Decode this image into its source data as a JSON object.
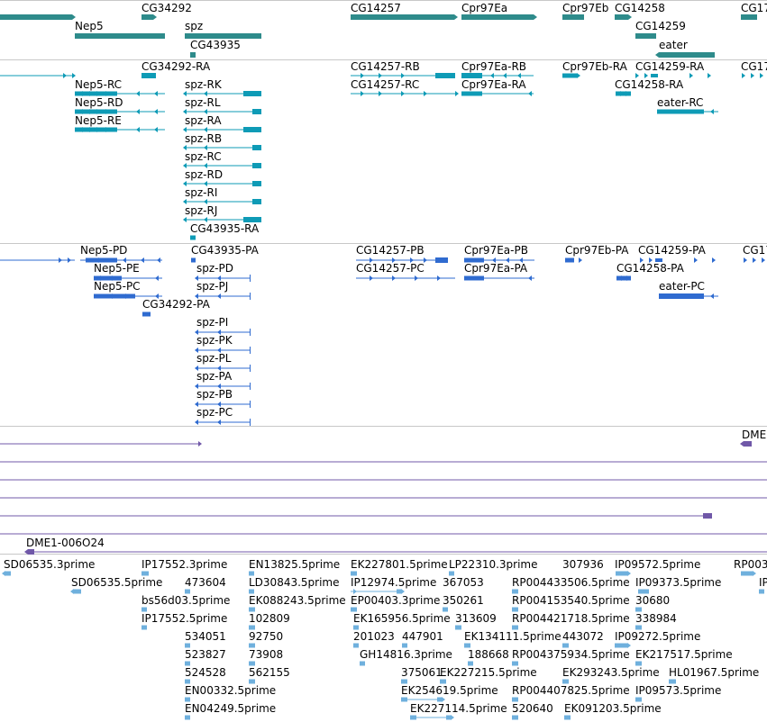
{
  "colors": {
    "gene": "#2e8b8b",
    "transcript_a": "#0e9bb6",
    "transcript_b": "#2f6bd0",
    "alignment": "#7058a8",
    "est": "#6fb0dd",
    "separator": "#c8c8c8"
  },
  "tracks": [
    {
      "name": "genes",
      "color": "gene",
      "features": [
        {
          "label": "CG34292"
        },
        {
          "label": "Nep5"
        },
        {
          "label": "spz"
        },
        {
          "label": "CG43935"
        },
        {
          "label": "CG14257"
        },
        {
          "label": "Cpr97Ea"
        },
        {
          "label": "Cpr97Eb"
        },
        {
          "label": "CG14258"
        },
        {
          "label": "CG14259"
        },
        {
          "label": "eater"
        },
        {
          "label": "CG17"
        }
      ]
    },
    {
      "name": "transcripts_1",
      "color": "transcript_a",
      "features": [
        {
          "label": "CG34292-RA"
        },
        {
          "label": "CG14257-RB"
        },
        {
          "label": "Cpr97Ea-RB"
        },
        {
          "label": "Cpr97Eb-RA"
        },
        {
          "label": "CG14259-RA"
        },
        {
          "label": "CG17"
        },
        {
          "label": "Nep5-RC"
        },
        {
          "label": "spz-RK"
        },
        {
          "label": "CG14257-RC"
        },
        {
          "label": "Cpr97Ea-RA"
        },
        {
          "label": "CG14258-RA"
        },
        {
          "label": "Nep5-RD"
        },
        {
          "label": "spz-RL"
        },
        {
          "label": "eater-RC"
        },
        {
          "label": "Nep5-RE"
        },
        {
          "label": "spz-RA"
        },
        {
          "label": "spz-RB"
        },
        {
          "label": "spz-RC"
        },
        {
          "label": "spz-RD"
        },
        {
          "label": "spz-RI"
        },
        {
          "label": "spz-RJ"
        },
        {
          "label": "CG43935-RA"
        }
      ]
    },
    {
      "name": "transcripts_2",
      "color": "transcript_b",
      "features": [
        {
          "label": "Nep5-PD"
        },
        {
          "label": "CG43935-PA"
        },
        {
          "label": "CG14257-PB"
        },
        {
          "label": "Cpr97Ea-PB"
        },
        {
          "label": "Cpr97Eb-PA"
        },
        {
          "label": "CG14259-PA"
        },
        {
          "label": "CG17"
        },
        {
          "label": "Nep5-PE"
        },
        {
          "label": "spz-PD"
        },
        {
          "label": "CG14257-PC"
        },
        {
          "label": "Cpr97Ea-PA"
        },
        {
          "label": "CG14258-PA"
        },
        {
          "label": "Nep5-PC"
        },
        {
          "label": "spz-PJ"
        },
        {
          "label": "eater-PC"
        },
        {
          "label": "CG34292-PA"
        },
        {
          "label": "spz-PI"
        },
        {
          "label": "spz-PK"
        },
        {
          "label": "spz-PL"
        },
        {
          "label": "spz-PA"
        },
        {
          "label": "spz-PB"
        },
        {
          "label": "spz-PC"
        }
      ]
    },
    {
      "name": "alignments",
      "color": "alignment",
      "features": [
        {
          "label": "DME"
        },
        {
          "label": "DME1-006O24"
        }
      ]
    },
    {
      "name": "ests",
      "color": "est",
      "features": [
        {
          "label": "SD06535.3prime"
        },
        {
          "label": "IP17552.3prime"
        },
        {
          "label": "EN13825.5prime"
        },
        {
          "label": "EK227801.5prime"
        },
        {
          "label": "LP22310.3prime"
        },
        {
          "label": "307936"
        },
        {
          "label": "IP09572.5prime"
        },
        {
          "label": "RP003"
        },
        {
          "label": "SD06535.5prime"
        },
        {
          "label": "473604"
        },
        {
          "label": "LD30843.5prime"
        },
        {
          "label": "IP12974.5prime"
        },
        {
          "label": "367053"
        },
        {
          "label": "RP004433506.5prime"
        },
        {
          "label": "IP09373.5prime"
        },
        {
          "label": "IP"
        },
        {
          "label": "bs56d03.5prime"
        },
        {
          "label": "EK088243.5prime"
        },
        {
          "label": "EP00403.3prime"
        },
        {
          "label": "350261"
        },
        {
          "label": "RP004153540.5prime"
        },
        {
          "label": "30680"
        },
        {
          "label": "IP17552.5prime"
        },
        {
          "label": "102809"
        },
        {
          "label": "EK165956.5prime"
        },
        {
          "label": "313609"
        },
        {
          "label": "RP004421718.5prime"
        },
        {
          "label": "338984"
        },
        {
          "label": "534051"
        },
        {
          "label": "92750"
        },
        {
          "label": "201023"
        },
        {
          "label": "447901"
        },
        {
          "label": "EK134111.5prime"
        },
        {
          "label": "443072"
        },
        {
          "label": "IP09272.5prime"
        },
        {
          "label": "523827"
        },
        {
          "label": "73908"
        },
        {
          "label": "GH14816.3prime"
        },
        {
          "label": "188668"
        },
        {
          "label": "RP004375934.5prime"
        },
        {
          "label": "EK217517.5prime"
        },
        {
          "label": "524528"
        },
        {
          "label": "562155"
        },
        {
          "label": "375061"
        },
        {
          "label": "EK227215.5prime"
        },
        {
          "label": "EK293243.5prime"
        },
        {
          "label": "HL01967.5prime"
        },
        {
          "label": "EN00332.5prime"
        },
        {
          "label": "EK254619.5prime"
        },
        {
          "label": "RP004407825.5prime"
        },
        {
          "label": "IP09573.5prime"
        },
        {
          "label": "EN04249.5prime"
        },
        {
          "label": "EK227114.5prime"
        },
        {
          "label": "520640"
        },
        {
          "label": "EK091203.5prime"
        }
      ]
    }
  ]
}
